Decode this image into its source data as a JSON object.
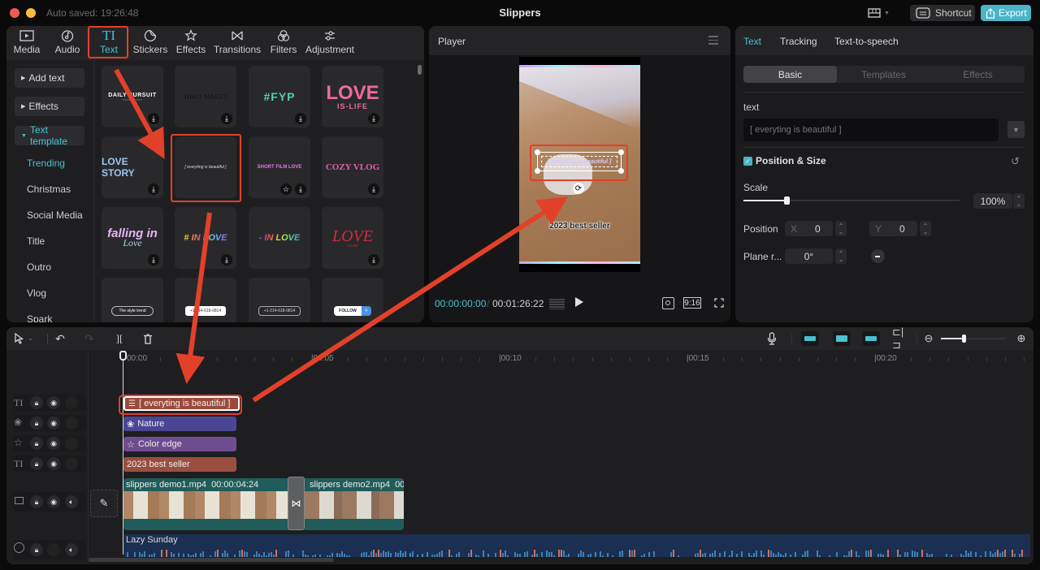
{
  "window": {
    "title": "Slippers",
    "autosave": "Auto saved: 19:26:48",
    "shortcut_label": "Shortcut",
    "export_label": "Export",
    "colors": {
      "accent": "#4bc0d0",
      "highlight": "#e3402a",
      "export_bg": "#4bb4c8"
    }
  },
  "categories": [
    {
      "label": "Media",
      "icon": "media-icon"
    },
    {
      "label": "Audio",
      "icon": "audio-icon"
    },
    {
      "label": "Text",
      "icon": "text-icon",
      "active": true
    },
    {
      "label": "Stickers",
      "icon": "stickers-icon"
    },
    {
      "label": "Effects",
      "icon": "effects-icon"
    },
    {
      "label": "Transitions",
      "icon": "transitions-icon"
    },
    {
      "label": "Filters",
      "icon": "filters-icon"
    },
    {
      "label": "Adjustment",
      "icon": "adjustment-icon"
    }
  ],
  "sidebar": {
    "buttons": [
      {
        "label": "Add text",
        "expanded": false
      },
      {
        "label": "Effects",
        "expanded": false
      },
      {
        "label": "Text template",
        "expanded": true
      }
    ],
    "subitems": [
      {
        "label": "Trending",
        "active": true
      },
      {
        "label": "Christmas"
      },
      {
        "label": "Social Media"
      },
      {
        "label": "Title"
      },
      {
        "label": "Outro"
      },
      {
        "label": "Vlog"
      },
      {
        "label": "Spark"
      }
    ]
  },
  "templates": [
    {
      "label": "DAILY PURSUIT",
      "sub": "WEEKEND VIBES",
      "download": true
    },
    {
      "label": "WHAT MAKES",
      "download": true
    },
    {
      "label": "#FYP",
      "download": true
    },
    {
      "label": "LOVE",
      "sub": "IS-LIFE",
      "download": true
    },
    {
      "label": "LOVE STORY",
      "download": true
    },
    {
      "label": "[ everyting is beautiful ]",
      "selected": true,
      "download": false
    },
    {
      "label": "SHORT FILM LOVE",
      "download": true,
      "favorite": true
    },
    {
      "label": "COZY VLOG",
      "download": true
    },
    {
      "label": "falling in",
      "sub": "Love",
      "download": true
    },
    {
      "label": "# IN LOVE",
      "download": true
    },
    {
      "label": "- IN LOVE",
      "download": false
    },
    {
      "label": "LOVE",
      "sub": "IS LIFE",
      "download": true
    },
    {
      "label": "The style trend"
    },
    {
      "label": "+1-214-618-0814"
    },
    {
      "label": "+1-214-618-0814"
    },
    {
      "label": "FOLLOW"
    }
  ],
  "player": {
    "title": "Player",
    "current_time": "00:00:00:00",
    "separator": "/",
    "total_time": "00:01:26:22",
    "ratio_label": "9:16",
    "overlay_text": "[ everyting is beautiful ]",
    "caption_text": "2023 best seller"
  },
  "inspector": {
    "tabs": [
      {
        "label": "Text",
        "active": true
      },
      {
        "label": "Tracking"
      },
      {
        "label": "Text-to-speech"
      }
    ],
    "subtabs": [
      {
        "label": "Basic",
        "active": true
      },
      {
        "label": "Templates"
      },
      {
        "label": "Effects"
      }
    ],
    "text_label": "text",
    "text_value": "[ everyting is beautiful ]",
    "position_size_label": "Position & Size",
    "position_size_checked": true,
    "scale_label": "Scale",
    "scale_value": "100%",
    "scale_fraction": 0.2,
    "position_label": "Position",
    "x_label": "X",
    "x_value": "0",
    "y_label": "Y",
    "y_value": "0",
    "rotation_label": "Plane r...",
    "rotation_value": "0°"
  },
  "timeline": {
    "ruler": [
      "00:00",
      "00:05",
      "00:10",
      "00:15",
      "00:20"
    ],
    "zoom_fraction": 0.35,
    "tracks": [
      {
        "type": "text",
        "icon": "text-track-icon",
        "clip": "[ everyting is beautiful ]",
        "selected": true
      },
      {
        "type": "filter",
        "icon": "filters-track-icon",
        "clip": "Nature"
      },
      {
        "type": "effect",
        "icon": "effects-track-icon",
        "clip": "Color edge"
      },
      {
        "type": "text",
        "icon": "text-track-icon",
        "clip": "2023 best seller"
      }
    ],
    "video": {
      "clip1_name": "slippers demo1.mp4",
      "clip1_duration": "00:00:04:24",
      "clip2_name": "slippers demo2.mp4",
      "clip2_duration": "00:0"
    },
    "audio": {
      "clip": "Lazy Sunday"
    }
  }
}
